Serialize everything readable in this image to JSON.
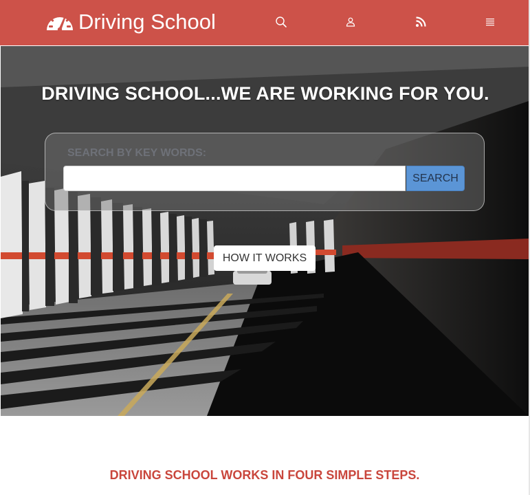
{
  "header": {
    "brand_name": "Driving School",
    "logo_icon": "speedometer-icon",
    "background_color": "#cd5249",
    "nav_icons": [
      "search-icon",
      "user-icon",
      "rss-icon",
      "menu-icon"
    ]
  },
  "hero": {
    "title": "DRIVING SCHOOL...WE ARE WORKING FOR YOU.",
    "search": {
      "label": "SEARCH BY KEY WORDS:",
      "input_value": "",
      "placeholder": "",
      "button_label": "SEARCH",
      "button_color": "#5b95d6"
    },
    "how_it_works_label": "HOW IT WORKS"
  },
  "steps": {
    "heading": "DRIVING SCHOOL WORKS IN FOUR SIMPLE STEPS.",
    "heading_color": "#c9463c"
  }
}
